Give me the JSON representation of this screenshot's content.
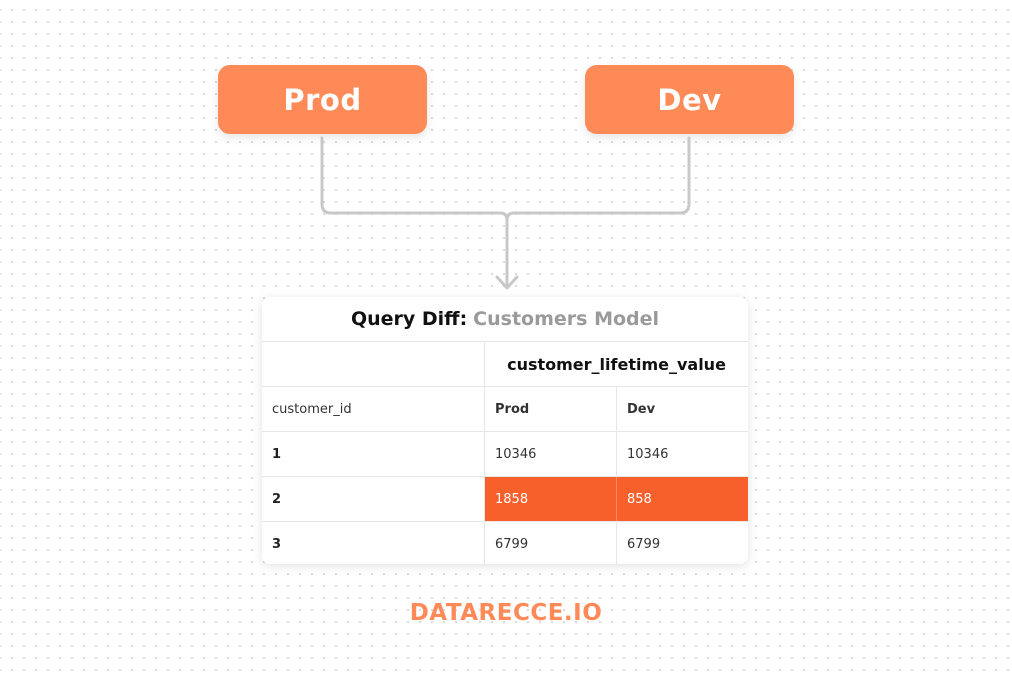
{
  "environments": {
    "prod": "Prod",
    "dev": "Dev"
  },
  "table": {
    "title_label": "Query Diff:",
    "title_model": "Customers Model",
    "column_group": "customer_lifetime_value",
    "headers": {
      "id": "customer_id",
      "prod": "Prod",
      "dev": "Dev"
    },
    "rows": [
      {
        "id": "1",
        "prod": "10346",
        "dev": "10346",
        "changed": false
      },
      {
        "id": "2",
        "prod": "1858",
        "dev": "858",
        "changed": true
      },
      {
        "id": "3",
        "prod": "6799",
        "dev": "6799",
        "changed": false
      }
    ]
  },
  "brand": "DATARECCE.IO",
  "colors": {
    "accent": "#fe8a57",
    "diff_highlight": "#f75f2b",
    "connector": "#c8c8c8"
  },
  "icons": {
    "arrow": "down-arrow-icon"
  }
}
